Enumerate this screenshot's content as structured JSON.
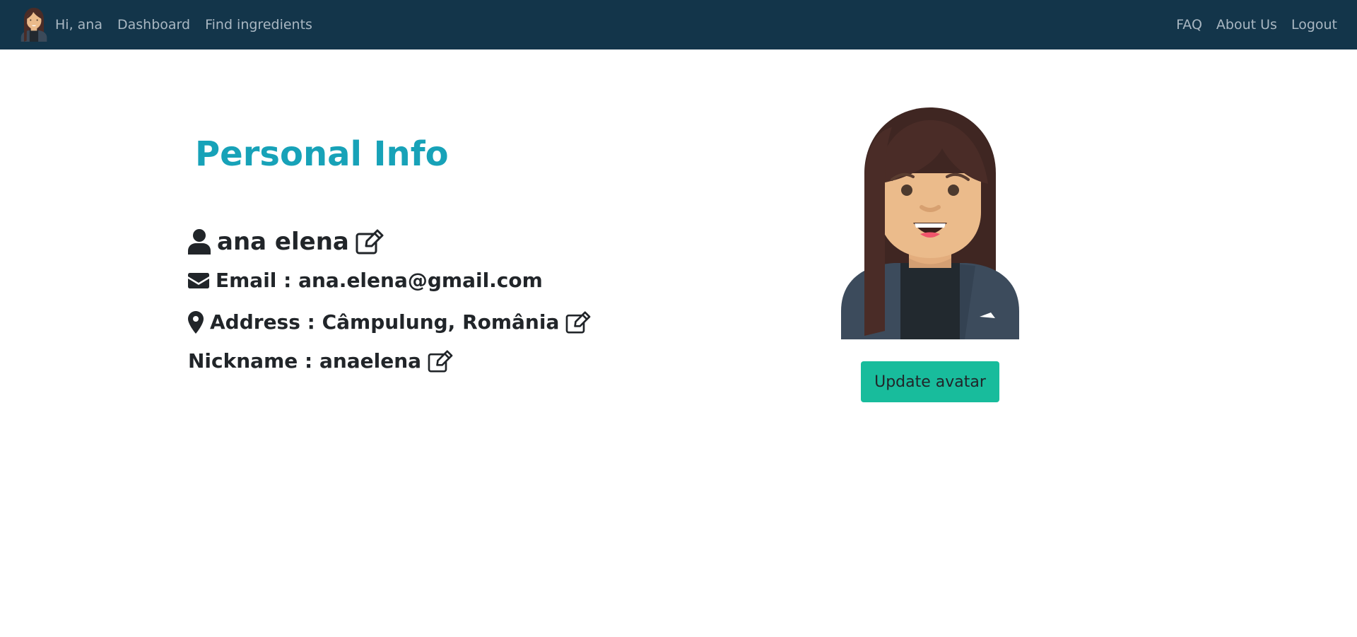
{
  "navbar": {
    "greeting": "Hi, ana",
    "links_left": [
      "Dashboard",
      "Find ingredients"
    ],
    "links_right": [
      "FAQ",
      "About Us",
      "Logout"
    ],
    "background": "#13354a",
    "avatar_icon": "woman-avatar-icon"
  },
  "profile": {
    "title": "Personal Info",
    "name": "ana elena",
    "email_text": "Email : ana.elena@gmail.com",
    "address_text": "Address : Câmpulung, România",
    "nickname_text": "Nickname : anaelena",
    "title_color": "#17a2b8",
    "icons": [
      "user-icon",
      "envelope-icon",
      "map-marker-icon",
      "edit-icon"
    ]
  },
  "avatar_panel": {
    "avatar_icon": "woman-avatar-icon",
    "update_button_label": "Update avatar",
    "button_color": "#18bc9c"
  }
}
